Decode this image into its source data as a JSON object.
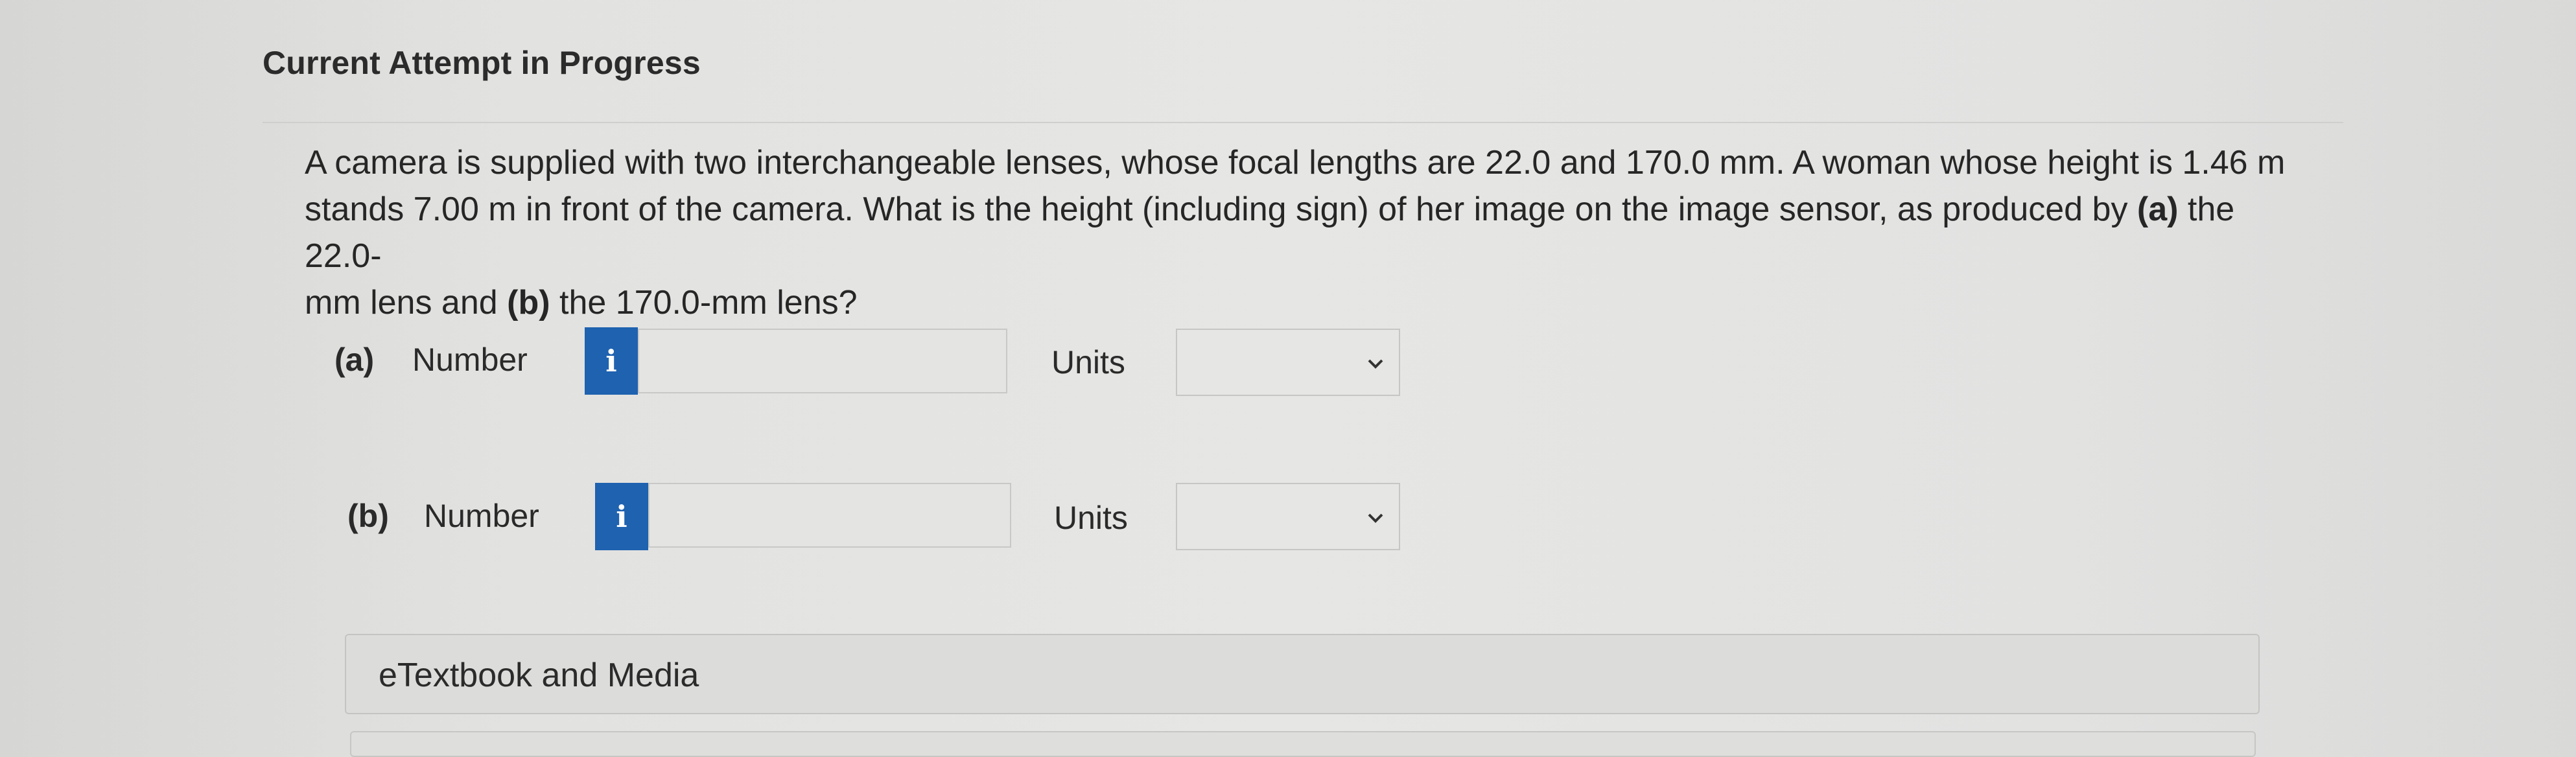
{
  "header": {
    "title": "Current Attempt in Progress"
  },
  "question": {
    "text_1": "A camera is supplied with two interchangeable lenses, whose focal lengths are 22.0 and 170.0 mm. A woman whose height is 1.46 m",
    "text_2": "stands 7.00 m in front of the camera. What is the height (including sign) of her image on the image sensor, as produced by ",
    "bold_a": "(a)",
    "text_3": " the 22.0-",
    "text_4": "mm lens and ",
    "bold_b": "(b)",
    "text_5": " the 170.0-mm lens?"
  },
  "part_a": {
    "label": "(a)",
    "number_label": "Number",
    "info_icon": "info-icon",
    "info_glyph": "i",
    "input_value": "",
    "units_label": "Units",
    "units_value": ""
  },
  "part_b": {
    "label": "(b)",
    "number_label": "Number",
    "info_icon": "info-icon",
    "info_glyph": "i",
    "input_value": "",
    "units_label": "Units",
    "units_value": ""
  },
  "resources": {
    "etextbook_label": "eTextbook and Media"
  },
  "colors": {
    "accent": "#1f62b0",
    "background": "#e3e3e1",
    "text": "#2a2a2a"
  }
}
